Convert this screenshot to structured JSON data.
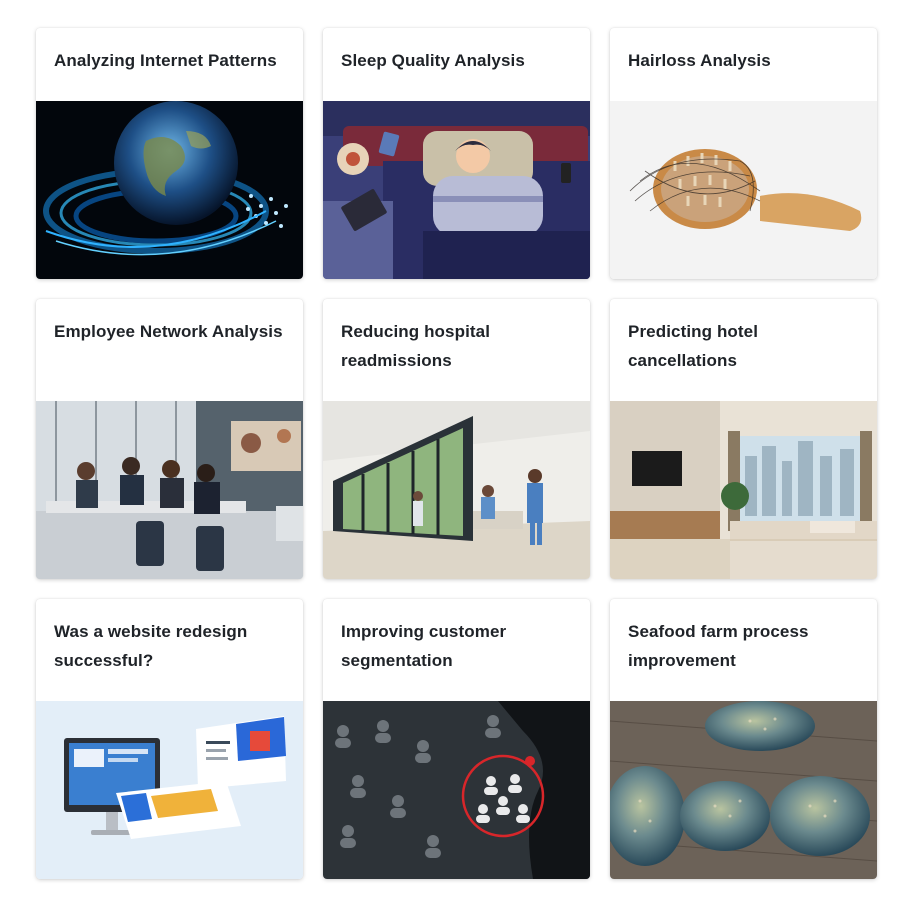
{
  "cards": [
    {
      "title": "Analyzing Internet Patterns",
      "image_icon": "globe-fiber-optic-image"
    },
    {
      "title": "Sleep Quality Analysis",
      "image_icon": "sleepless-person-image"
    },
    {
      "title": "Hairloss Analysis",
      "image_icon": "hairbrush-image"
    },
    {
      "title": "Employee Network Analysis",
      "image_icon": "office-meeting-image"
    },
    {
      "title": "Reducing hospital readmissions",
      "image_icon": "hospital-corridor-image"
    },
    {
      "title": "Predicting hotel cancellations",
      "image_icon": "hotel-room-image"
    },
    {
      "title": "Was a website redesign successful?",
      "image_icon": "website-devices-image"
    },
    {
      "title": "Improving customer segmentation",
      "image_icon": "customer-network-image"
    },
    {
      "title": "Seafood farm process improvement",
      "image_icon": "abalone-shells-image"
    }
  ]
}
